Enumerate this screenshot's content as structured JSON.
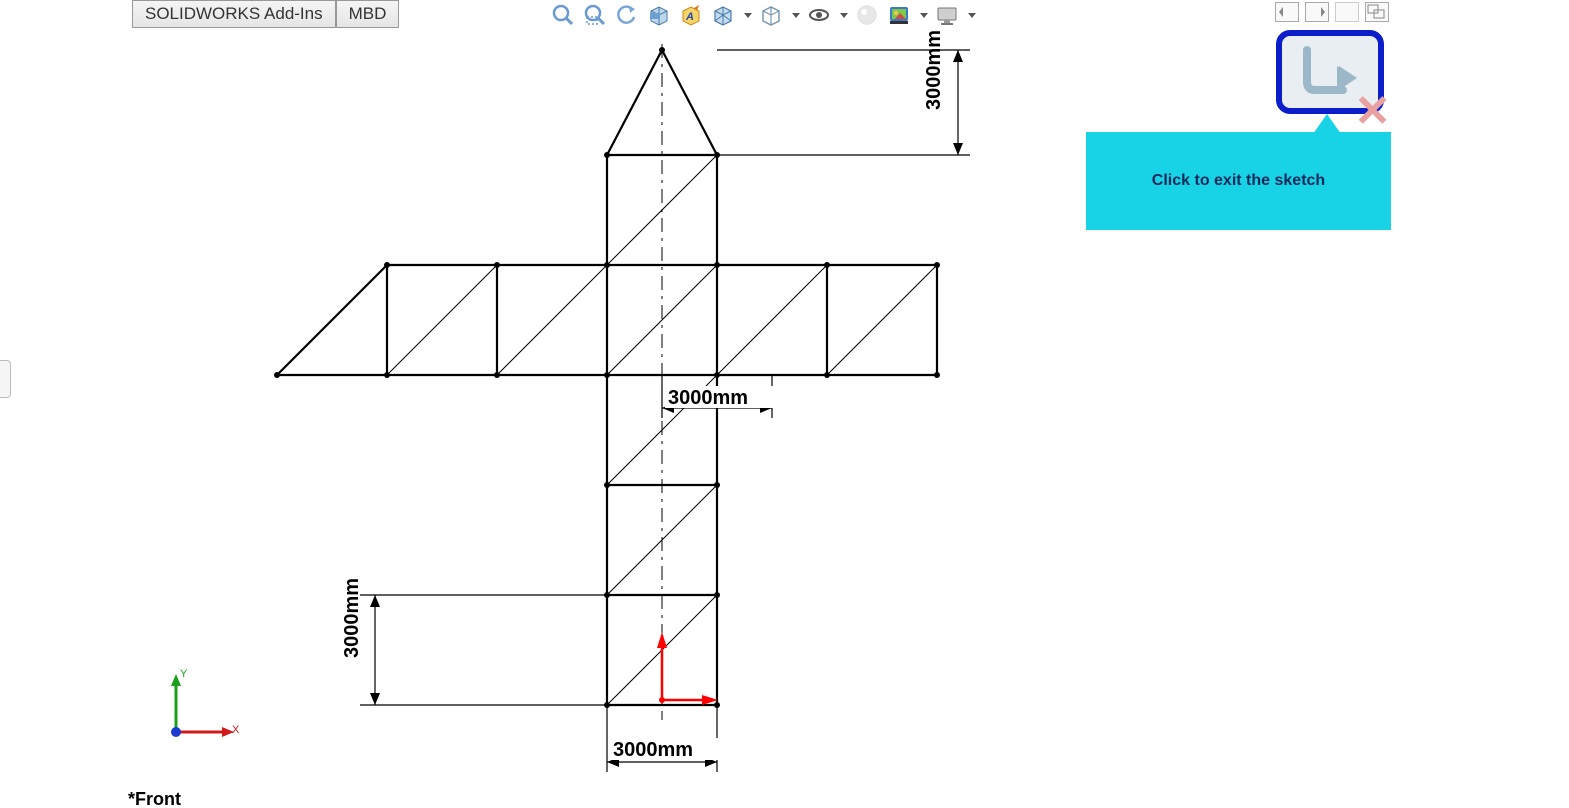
{
  "tabs": {
    "addins": "SOLIDWORKS Add-Ins",
    "mbd": "MBD"
  },
  "tooltip": {
    "text": "Click to exit the sketch"
  },
  "dimensions": {
    "top_right_vert": "3000mm",
    "mid_horiz": "3000mm",
    "bottom_left_vert": "3000mm",
    "bottom_horiz": "3000mm"
  },
  "triad": {
    "x": "X",
    "y": "Y"
  },
  "view": {
    "name": "*Front"
  },
  "icons": {
    "zoom_fit": "zoom-to-fit",
    "zoom_area": "zoom-to-area",
    "prev_view": "previous-view",
    "section": "section-view",
    "dynamic_annot": "dynamic-annotation",
    "view_orient": "view-orientation",
    "display_style": "display-style",
    "hide_show": "hide-show-items",
    "realview": "realview",
    "appearance": "edit-appearance",
    "apply_scene": "apply-scene",
    "view_settings": "view-settings"
  }
}
